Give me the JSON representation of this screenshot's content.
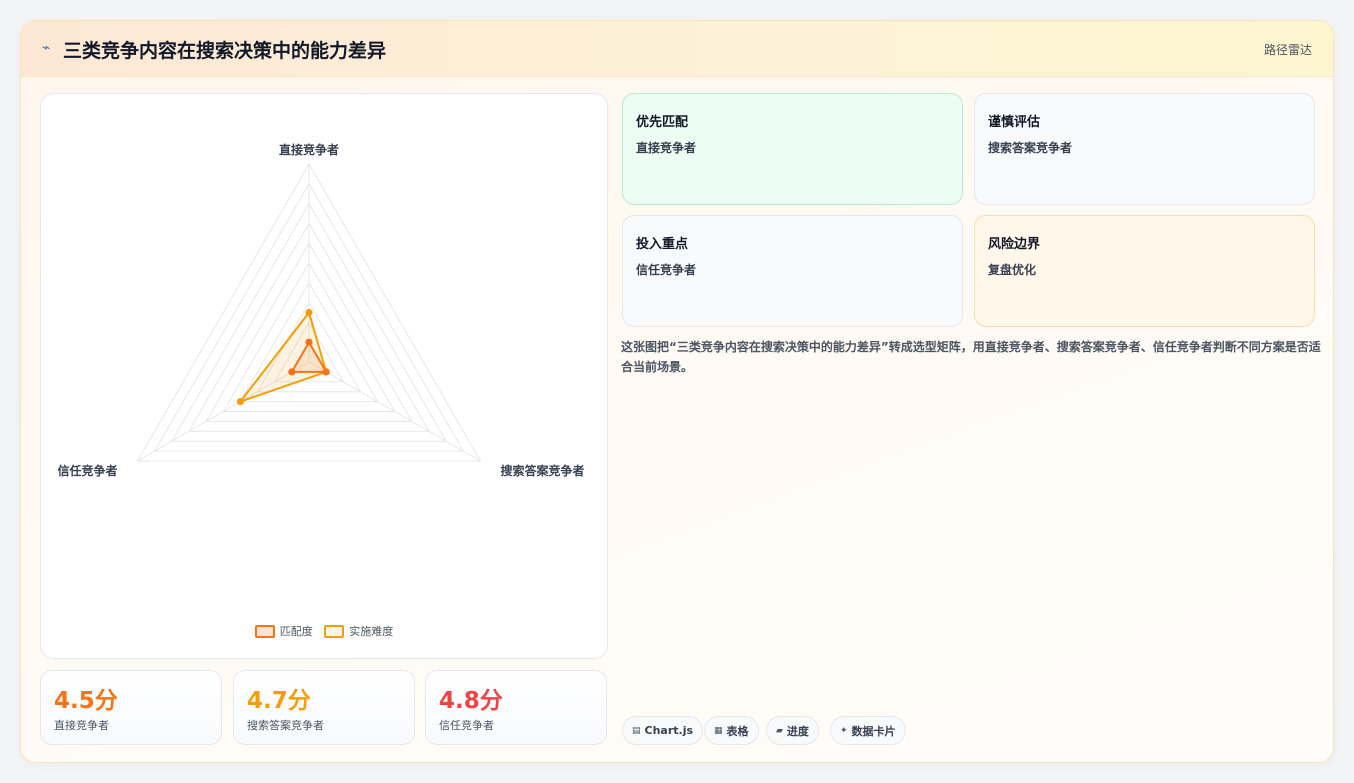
{
  "header": {
    "icon": "lightning-icon",
    "title": "三类竞争内容在搜索决策中的能力差异",
    "tag": "路径雷达"
  },
  "chart_data": {
    "type": "radar",
    "categories": [
      "直接竞争者",
      "搜索答案竞争者",
      "信任竞争者"
    ],
    "series": [
      {
        "name": "匹配度",
        "values": [
          1.0,
          1.0,
          1.0
        ],
        "color": "#f97316"
      },
      {
        "name": "实施难度",
        "values": [
          2.5,
          1.0,
          4.0
        ],
        "color": "#f59e0b"
      }
    ],
    "rlim": [
      0,
      10
    ],
    "grid": true,
    "legend_position": "bottom"
  },
  "stats": [
    {
      "value": "4.5分",
      "label": "直接竞争者",
      "color": "#f97316"
    },
    {
      "value": "4.7分",
      "label": "搜索答案竞争者",
      "color": "#f59e0b"
    },
    {
      "value": "4.8分",
      "label": "信任竞争者",
      "color": "#ef4444"
    }
  ],
  "cards": [
    {
      "title": "优先匹配",
      "subtitle": "直接竞争者"
    },
    {
      "title": "谨慎评估",
      "subtitle": "搜索答案竞争者"
    },
    {
      "title": "投入重点",
      "subtitle": "信任竞争者"
    },
    {
      "title": "风险边界",
      "subtitle": "复盘优化"
    }
  ],
  "description": "这张图把“三类竞争内容在搜索决策中的能力差异”转成选型矩阵，用直接竞争者、搜索答案竞争者、信任竞争者判断不同方案是否适合当前场景。",
  "chips": [
    {
      "icon": "chart-icon",
      "label": "Chart.js"
    },
    {
      "icon": "table-icon",
      "label": "表格"
    },
    {
      "icon": "progress-icon",
      "label": "进度"
    },
    {
      "icon": "sparkle-icon",
      "label": "数据卡片"
    }
  ]
}
